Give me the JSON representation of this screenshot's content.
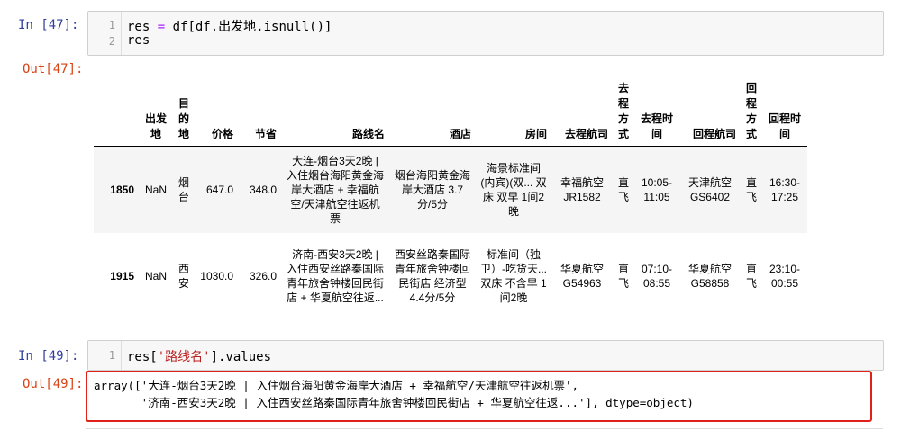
{
  "cell47": {
    "in_prompt": "In  [47]:",
    "out_prompt": "Out[47]:",
    "line_numbers": [
      "1",
      "2"
    ],
    "code_line1_a": "res ",
    "code_line1_op": "=",
    "code_line1_b": " df[df.出发地.isnull()]",
    "code_line2": "res"
  },
  "table": {
    "headers": [
      "",
      "出发地",
      "目的地",
      "价格",
      "节省",
      "路线名",
      "酒店",
      "房间",
      "去程航司",
      "去程方式",
      "去程时间",
      "回程航司",
      "回程方式",
      "回程时间"
    ],
    "rows": [
      {
        "index": "1850",
        "cells": [
          "NaN",
          "烟台",
          "647.0",
          "348.0",
          "大连-烟台3天2晚 | 入住烟台海阳黄金海岸大酒店 + 幸福航空/天津航空往返机票",
          "烟台海阳黄金海岸大酒店 3.7分/5分",
          "海景标准间(内宾)(双... 双床 双早 1间2晚",
          "幸福航空 JR1582",
          "直飞",
          "10:05-11:05",
          "天津航空 GS6402",
          "直飞",
          "16:30-17:25"
        ]
      },
      {
        "index": "1915",
        "cells": [
          "NaN",
          "西安",
          "1030.0",
          "326.0",
          "济南-西安3天2晚 | 入住西安丝路秦国际青年旅舍钟楼回民街店 + 华夏航空往返...",
          "西安丝路秦国际青年旅舍钟楼回民街店 经济型 4.4分/5分",
          "标准间（独卫）-吃货天... 双床 不含早 1间2晚",
          "华夏航空 G54963",
          "直飞",
          "07:10-08:55",
          "华夏航空 G58858",
          "直飞",
          "23:10-00:55"
        ]
      }
    ]
  },
  "cell49": {
    "in_prompt": "In  [49]:",
    "out_prompt": "Out[49]:",
    "line_number": "1",
    "code_a": "res[",
    "code_str": "'路线名'",
    "code_b": "].values",
    "output_line1": "array(['大连-烟台3天2晚 | 入住烟台海阳黄金海岸大酒店 + 幸福航空/天津航空往返机票',",
    "output_line2": "       '济南-西安3天2晚 | 入住西安丝路秦国际青年旅舍钟楼回民街店 + 华夏航空往返...'], dtype=object)"
  },
  "colors": {
    "in_prompt": "#303f9f",
    "out_prompt": "#d84315",
    "highlight_box": "#e0201b"
  }
}
